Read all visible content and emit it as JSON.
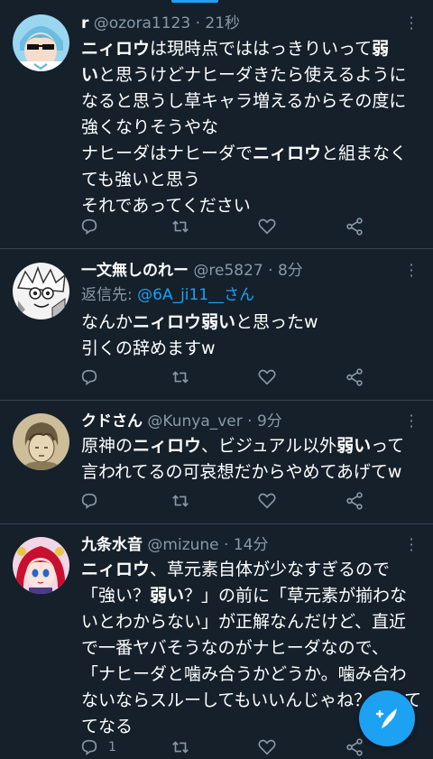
{
  "tweets": [
    {
      "name": "r",
      "handle": "@ozora1123",
      "time": "21秒",
      "lines": [
        [
          "",
          "ニィロウ",
          "は現時点でははっきりいって",
          "弱"
        ],
        [
          "",
          "い",
          "と思うけどナヒーダきたら使えるように"
        ],
        [
          "なると思うし草キャラ増えるからその度に"
        ],
        [
          "強くなりそうやな"
        ],
        [
          "ナヒーダはナヒーダで",
          "ニィロウ",
          "と組まなく"
        ],
        [
          "ても強いと思う"
        ],
        [
          "それであってください"
        ]
      ],
      "reply_count": "",
      "avatar_color": "#7ec9e8"
    },
    {
      "name": "一文無しのれー",
      "handle": "@re5827",
      "time": "8分",
      "reply_prefix": "返信先: ",
      "reply_mention": "@6A_ji11__さん",
      "lines": [
        [
          "なんか",
          "ニィロウ弱い",
          "と思ったw"
        ],
        [
          "引くの辞めますw"
        ]
      ],
      "reply_count": ""
    },
    {
      "name": "クドさん",
      "handle": "@Kunya_ver",
      "time": "9分",
      "lines": [
        [
          "原神の",
          "ニィロウ",
          "、ビジュアル以外",
          "弱い",
          "って"
        ],
        [
          "言われてるの可哀想だからやめてあげてw"
        ]
      ],
      "reply_count": ""
    },
    {
      "name": "九条水音",
      "handle": "@mizune",
      "time": "14分",
      "lines": [
        [
          "",
          "ニィロウ",
          "、草元素自体が少なすぎるので"
        ],
        [
          "「強い？",
          "弱い",
          "？」の前に「草元素が揃わな"
        ],
        [
          "いとわからない」が正解なんだけど、直近"
        ],
        [
          "で一番ヤバそうなのがナヒーダなので、"
        ],
        [
          "「ナヒーダと噛み合うかどうか。噛み合わ"
        ],
        [
          "ないならスルーしてもいいんじゃね？」って"
        ],
        [
          "てなる"
        ]
      ],
      "reply_count": "1"
    }
  ],
  "separator": " · ",
  "colors": {
    "background": "#15202b",
    "text": "#ffffff",
    "secondary": "#8899a6",
    "accent": "#1da1f2",
    "divider": "#38444d"
  },
  "icons": {
    "reply": "reply-icon",
    "retweet": "retweet-icon",
    "like": "like-icon",
    "share": "share-icon",
    "more": "more-options-icon",
    "compose": "compose-tweet-icon"
  }
}
